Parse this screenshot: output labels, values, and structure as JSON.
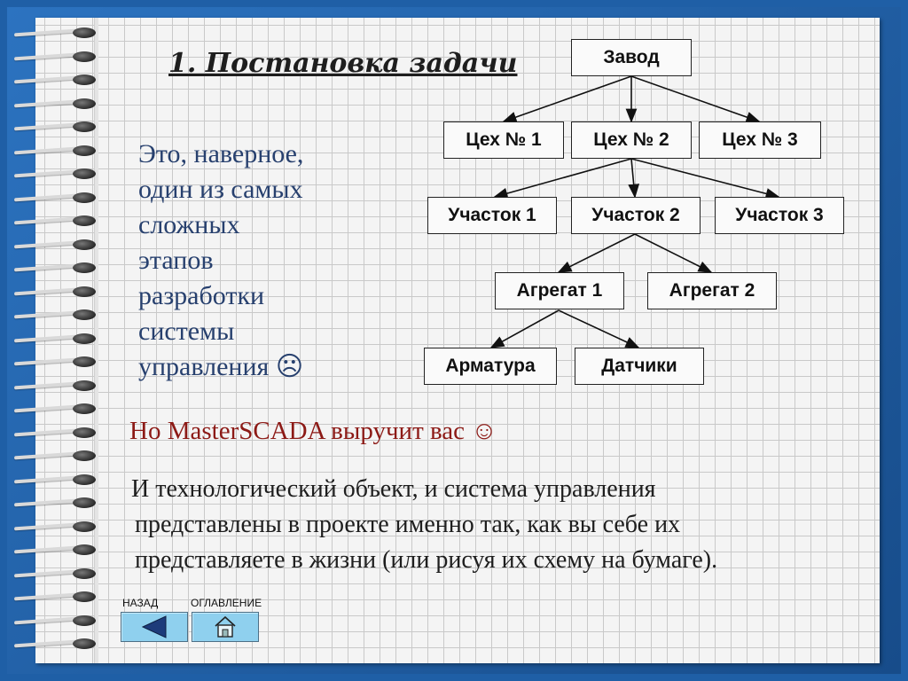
{
  "slide": {
    "title": "1. Постановка задачи",
    "intro_lines": [
      "Это, наверное,",
      "один из самых",
      "сложных",
      "этапов",
      "разработки",
      "системы",
      "управления ☹"
    ],
    "highlight": "Но MasterSCADA выручит вас ☺",
    "body_lines": [
      "И технологический объект, и система управления",
      "представлены в проекте именно так, как вы себе их",
      "представляете в жизни (или рисуя их схему на бумаге)."
    ]
  },
  "diagram": {
    "root": "Завод",
    "shops": [
      "Цех № 1",
      "Цех № 2",
      "Цех № 3"
    ],
    "sections": [
      "Участок 1",
      "Участок 2",
      "Участок 3"
    ],
    "units": [
      "Агрегат 1",
      "Агрегат 2"
    ],
    "parts": [
      "Арматура",
      "Датчики"
    ]
  },
  "navigation": {
    "back_label": "НАЗАД",
    "contents_label": "ОГЛАВЛЕНИЕ",
    "button_color": "#8fd0ee"
  },
  "colors": {
    "frame": "#1f5fa6",
    "intro_text": "#27406e",
    "highlight_text": "#8c1a16"
  }
}
